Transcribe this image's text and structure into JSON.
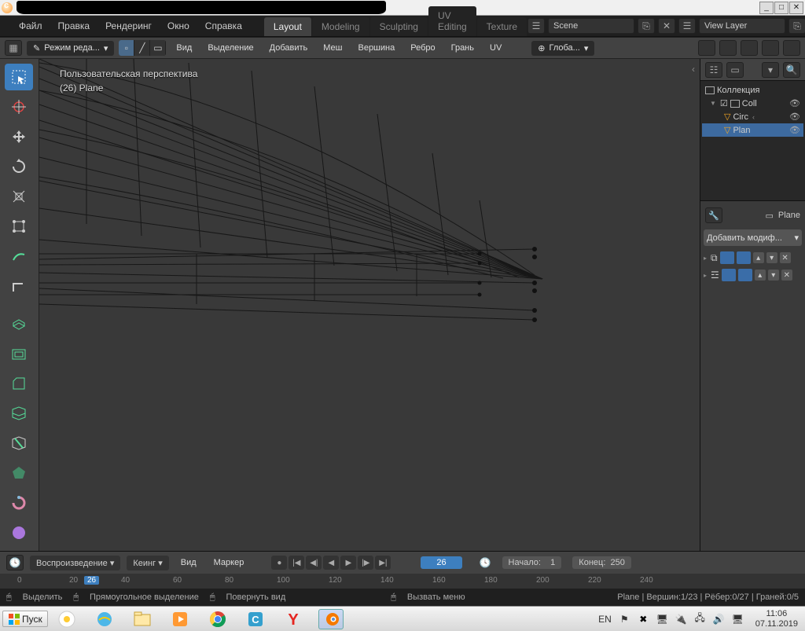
{
  "menu": {
    "file": "Файл",
    "edit": "Правка",
    "render": "Рендеринг",
    "window": "Окно",
    "help": "Справка"
  },
  "workspaces": {
    "layout": "Layout",
    "modeling": "Modeling",
    "sculpting": "Sculpting",
    "uv": "UV Editing",
    "texture": "Texture"
  },
  "scene": "Scene",
  "layer": "View Layer",
  "mode": "Режим реда...",
  "hdr2": {
    "view": "Вид",
    "select": "Выделение",
    "add": "Добавить",
    "mesh": "Меш",
    "vertex": "Вершина",
    "edge": "Ребро",
    "face": "Грань",
    "uv": "UV",
    "orient": "Глоба..."
  },
  "overlay": {
    "persp": "Пользовательская перспектива",
    "obj": "(26) Plane"
  },
  "outliner": {
    "title": "Коллекция",
    "coll": "Coll",
    "circ": "Circ",
    "plane": "Plan"
  },
  "props": {
    "obj": "Plane",
    "add": "Добавить модиф..."
  },
  "timeline": {
    "playback": "Воспроизведение",
    "keying": "Кеинг",
    "view": "Вид",
    "marker": "Маркер",
    "frame": "26",
    "start_lbl": "Начало:",
    "start": "1",
    "end_lbl": "Конец:",
    "end": "250"
  },
  "ruler": {
    "t0": "0",
    "t20": "20",
    "t26": "26",
    "t40": "40",
    "t60": "60",
    "t80": "80",
    "t100": "100",
    "t120": "120",
    "t140": "140",
    "t160": "160",
    "t180": "180",
    "t200": "200",
    "t220": "220",
    "t240": "240"
  },
  "status": {
    "select": "Выделить",
    "box": "Прямоугольное выделение",
    "rotate": "Повернуть вид",
    "menu": "Вызвать меню",
    "info": "Plane  |  Вершин:1/23  |  Рёбер:0/27  |  Граней:0/5"
  },
  "taskbar": {
    "start": "Пуск",
    "lang": "EN",
    "time": "11:06",
    "date": "07.11.2019"
  }
}
